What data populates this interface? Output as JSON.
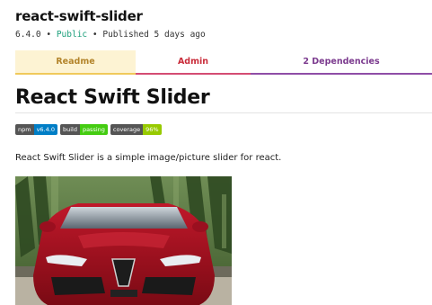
{
  "package": {
    "name": "react-swift-slider",
    "version": "6.4.0",
    "separator": "•",
    "visibility": "Public",
    "published": "Published 5 days ago"
  },
  "tabs": [
    {
      "label": "Readme",
      "color": "#b3842b"
    },
    {
      "label": "Admin",
      "color": "#c92c3a"
    },
    {
      "label": "2  Dependencies",
      "color": "#7b3a8e"
    }
  ],
  "readme": {
    "heading": "React Swift Slider",
    "badges": [
      {
        "left": "npm",
        "right": "v6.4.0",
        "color": "#007ec6"
      },
      {
        "left": "build",
        "right": "passing",
        "color": "#44cc11"
      },
      {
        "left": "coverage",
        "right": "96%",
        "color": "#97ca00"
      }
    ],
    "description": "React Swift Slider is a simple image/picture slider for react."
  }
}
